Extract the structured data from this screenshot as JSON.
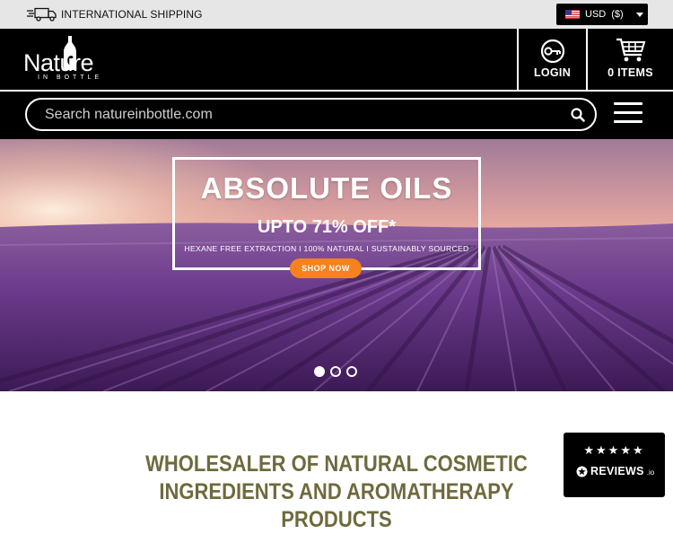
{
  "topbar": {
    "shipping_text": "INTERNATIONAL SHIPPING",
    "shipping_icon": "truck-icon",
    "currency_label": "USD",
    "currency_symbol": "($)",
    "currency_flag": "us-flag-icon"
  },
  "header": {
    "logo_word": "Nature",
    "logo_sub": "IN BOTTLE",
    "login_label": "LOGIN",
    "login_icon": "key-icon",
    "cart_label": "0 ITEMS",
    "cart_icon": "cart-icon"
  },
  "search": {
    "placeholder": "Search natureinbottle.com",
    "value": "",
    "icon": "search-icon"
  },
  "hero": {
    "title": "ABSOLUTE OILS",
    "subtitle": "UPTO 71% OFF*",
    "tagline": "HEXANE FREE EXTRACTION I 100% NATURAL I SUSTAINABLY SOURCED",
    "cta": "SHOP NOW",
    "slides_total": 3,
    "active_slide": 1
  },
  "headline": {
    "line1": "WHOLESALER OF NATURAL COSMETIC",
    "line2": "INGREDIENTS AND AROMATHERAPY PRODUCTS"
  },
  "reviews_badge": {
    "stars": "★★★★★",
    "rating": 4.5,
    "brand": "REVIEWS",
    "brand_suffix": ".io"
  },
  "colors": {
    "topbar_bg": "#e6e6e6",
    "header_bg": "#000000",
    "cta_orange": "#f5821f",
    "headline_olive": "#6e6a3e",
    "lavender": "#6b3a8c"
  }
}
